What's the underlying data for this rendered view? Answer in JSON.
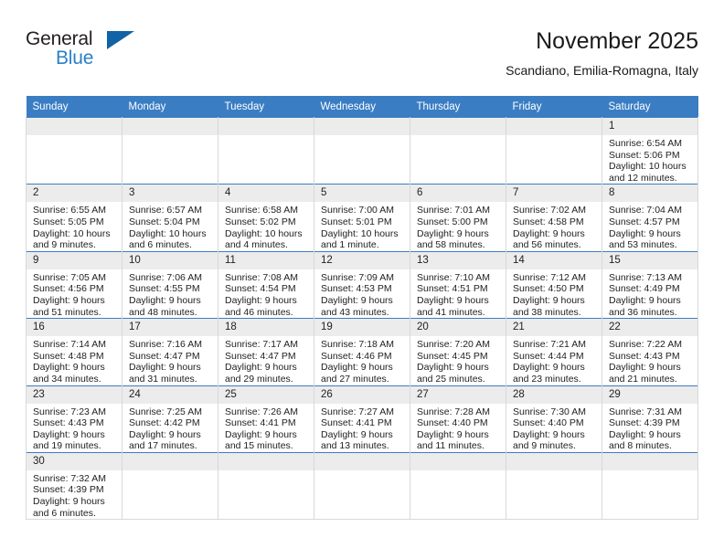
{
  "logo": {
    "word_one": "General",
    "word_two": "Blue",
    "triangle_icon": "triangle-icon"
  },
  "header": {
    "title": "November 2025",
    "subtitle": "Scandiano, Emilia-Romagna, Italy"
  },
  "calendar": {
    "weekday_headers": [
      "Sunday",
      "Monday",
      "Tuesday",
      "Wednesday",
      "Thursday",
      "Friday",
      "Saturday"
    ],
    "labels": {
      "sunrise": "Sunrise:",
      "sunset": "Sunset:",
      "daylight": "Daylight:"
    },
    "accent_color": "#3a7dc3",
    "daynum_bg": "#ececec",
    "weeks": [
      [
        {
          "day": "",
          "empty": true
        },
        {
          "day": "",
          "empty": true
        },
        {
          "day": "",
          "empty": true
        },
        {
          "day": "",
          "empty": true
        },
        {
          "day": "",
          "empty": true
        },
        {
          "day": "",
          "empty": true
        },
        {
          "day": "1",
          "sunrise": "Sunrise: 6:54 AM",
          "sunset": "Sunset: 5:06 PM",
          "daylight_1": "Daylight: 10 hours",
          "daylight_2": "and 12 minutes."
        }
      ],
      [
        {
          "day": "2",
          "sunrise": "Sunrise: 6:55 AM",
          "sunset": "Sunset: 5:05 PM",
          "daylight_1": "Daylight: 10 hours",
          "daylight_2": "and 9 minutes."
        },
        {
          "day": "3",
          "sunrise": "Sunrise: 6:57 AM",
          "sunset": "Sunset: 5:04 PM",
          "daylight_1": "Daylight: 10 hours",
          "daylight_2": "and 6 minutes."
        },
        {
          "day": "4",
          "sunrise": "Sunrise: 6:58 AM",
          "sunset": "Sunset: 5:02 PM",
          "daylight_1": "Daylight: 10 hours",
          "daylight_2": "and 4 minutes."
        },
        {
          "day": "5",
          "sunrise": "Sunrise: 7:00 AM",
          "sunset": "Sunset: 5:01 PM",
          "daylight_1": "Daylight: 10 hours",
          "daylight_2": "and 1 minute."
        },
        {
          "day": "6",
          "sunrise": "Sunrise: 7:01 AM",
          "sunset": "Sunset: 5:00 PM",
          "daylight_1": "Daylight: 9 hours",
          "daylight_2": "and 58 minutes."
        },
        {
          "day": "7",
          "sunrise": "Sunrise: 7:02 AM",
          "sunset": "Sunset: 4:58 PM",
          "daylight_1": "Daylight: 9 hours",
          "daylight_2": "and 56 minutes."
        },
        {
          "day": "8",
          "sunrise": "Sunrise: 7:04 AM",
          "sunset": "Sunset: 4:57 PM",
          "daylight_1": "Daylight: 9 hours",
          "daylight_2": "and 53 minutes."
        }
      ],
      [
        {
          "day": "9",
          "sunrise": "Sunrise: 7:05 AM",
          "sunset": "Sunset: 4:56 PM",
          "daylight_1": "Daylight: 9 hours",
          "daylight_2": "and 51 minutes."
        },
        {
          "day": "10",
          "sunrise": "Sunrise: 7:06 AM",
          "sunset": "Sunset: 4:55 PM",
          "daylight_1": "Daylight: 9 hours",
          "daylight_2": "and 48 minutes."
        },
        {
          "day": "11",
          "sunrise": "Sunrise: 7:08 AM",
          "sunset": "Sunset: 4:54 PM",
          "daylight_1": "Daylight: 9 hours",
          "daylight_2": "and 46 minutes."
        },
        {
          "day": "12",
          "sunrise": "Sunrise: 7:09 AM",
          "sunset": "Sunset: 4:53 PM",
          "daylight_1": "Daylight: 9 hours",
          "daylight_2": "and 43 minutes."
        },
        {
          "day": "13",
          "sunrise": "Sunrise: 7:10 AM",
          "sunset": "Sunset: 4:51 PM",
          "daylight_1": "Daylight: 9 hours",
          "daylight_2": "and 41 minutes."
        },
        {
          "day": "14",
          "sunrise": "Sunrise: 7:12 AM",
          "sunset": "Sunset: 4:50 PM",
          "daylight_1": "Daylight: 9 hours",
          "daylight_2": "and 38 minutes."
        },
        {
          "day": "15",
          "sunrise": "Sunrise: 7:13 AM",
          "sunset": "Sunset: 4:49 PM",
          "daylight_1": "Daylight: 9 hours",
          "daylight_2": "and 36 minutes."
        }
      ],
      [
        {
          "day": "16",
          "sunrise": "Sunrise: 7:14 AM",
          "sunset": "Sunset: 4:48 PM",
          "daylight_1": "Daylight: 9 hours",
          "daylight_2": "and 34 minutes."
        },
        {
          "day": "17",
          "sunrise": "Sunrise: 7:16 AM",
          "sunset": "Sunset: 4:47 PM",
          "daylight_1": "Daylight: 9 hours",
          "daylight_2": "and 31 minutes."
        },
        {
          "day": "18",
          "sunrise": "Sunrise: 7:17 AM",
          "sunset": "Sunset: 4:47 PM",
          "daylight_1": "Daylight: 9 hours",
          "daylight_2": "and 29 minutes."
        },
        {
          "day": "19",
          "sunrise": "Sunrise: 7:18 AM",
          "sunset": "Sunset: 4:46 PM",
          "daylight_1": "Daylight: 9 hours",
          "daylight_2": "and 27 minutes."
        },
        {
          "day": "20",
          "sunrise": "Sunrise: 7:20 AM",
          "sunset": "Sunset: 4:45 PM",
          "daylight_1": "Daylight: 9 hours",
          "daylight_2": "and 25 minutes."
        },
        {
          "day": "21",
          "sunrise": "Sunrise: 7:21 AM",
          "sunset": "Sunset: 4:44 PM",
          "daylight_1": "Daylight: 9 hours",
          "daylight_2": "and 23 minutes."
        },
        {
          "day": "22",
          "sunrise": "Sunrise: 7:22 AM",
          "sunset": "Sunset: 4:43 PM",
          "daylight_1": "Daylight: 9 hours",
          "daylight_2": "and 21 minutes."
        }
      ],
      [
        {
          "day": "23",
          "sunrise": "Sunrise: 7:23 AM",
          "sunset": "Sunset: 4:43 PM",
          "daylight_1": "Daylight: 9 hours",
          "daylight_2": "and 19 minutes."
        },
        {
          "day": "24",
          "sunrise": "Sunrise: 7:25 AM",
          "sunset": "Sunset: 4:42 PM",
          "daylight_1": "Daylight: 9 hours",
          "daylight_2": "and 17 minutes."
        },
        {
          "day": "25",
          "sunrise": "Sunrise: 7:26 AM",
          "sunset": "Sunset: 4:41 PM",
          "daylight_1": "Daylight: 9 hours",
          "daylight_2": "and 15 minutes."
        },
        {
          "day": "26",
          "sunrise": "Sunrise: 7:27 AM",
          "sunset": "Sunset: 4:41 PM",
          "daylight_1": "Daylight: 9 hours",
          "daylight_2": "and 13 minutes."
        },
        {
          "day": "27",
          "sunrise": "Sunrise: 7:28 AM",
          "sunset": "Sunset: 4:40 PM",
          "daylight_1": "Daylight: 9 hours",
          "daylight_2": "and 11 minutes."
        },
        {
          "day": "28",
          "sunrise": "Sunrise: 7:30 AM",
          "sunset": "Sunset: 4:40 PM",
          "daylight_1": "Daylight: 9 hours",
          "daylight_2": "and 9 minutes."
        },
        {
          "day": "29",
          "sunrise": "Sunrise: 7:31 AM",
          "sunset": "Sunset: 4:39 PM",
          "daylight_1": "Daylight: 9 hours",
          "daylight_2": "and 8 minutes."
        }
      ],
      [
        {
          "day": "30",
          "sunrise": "Sunrise: 7:32 AM",
          "sunset": "Sunset: 4:39 PM",
          "daylight_1": "Daylight: 9 hours",
          "daylight_2": "and 6 minutes."
        },
        {
          "day": "",
          "empty": true
        },
        {
          "day": "",
          "empty": true
        },
        {
          "day": "",
          "empty": true
        },
        {
          "day": "",
          "empty": true
        },
        {
          "day": "",
          "empty": true
        },
        {
          "day": "",
          "empty": true
        }
      ]
    ]
  }
}
